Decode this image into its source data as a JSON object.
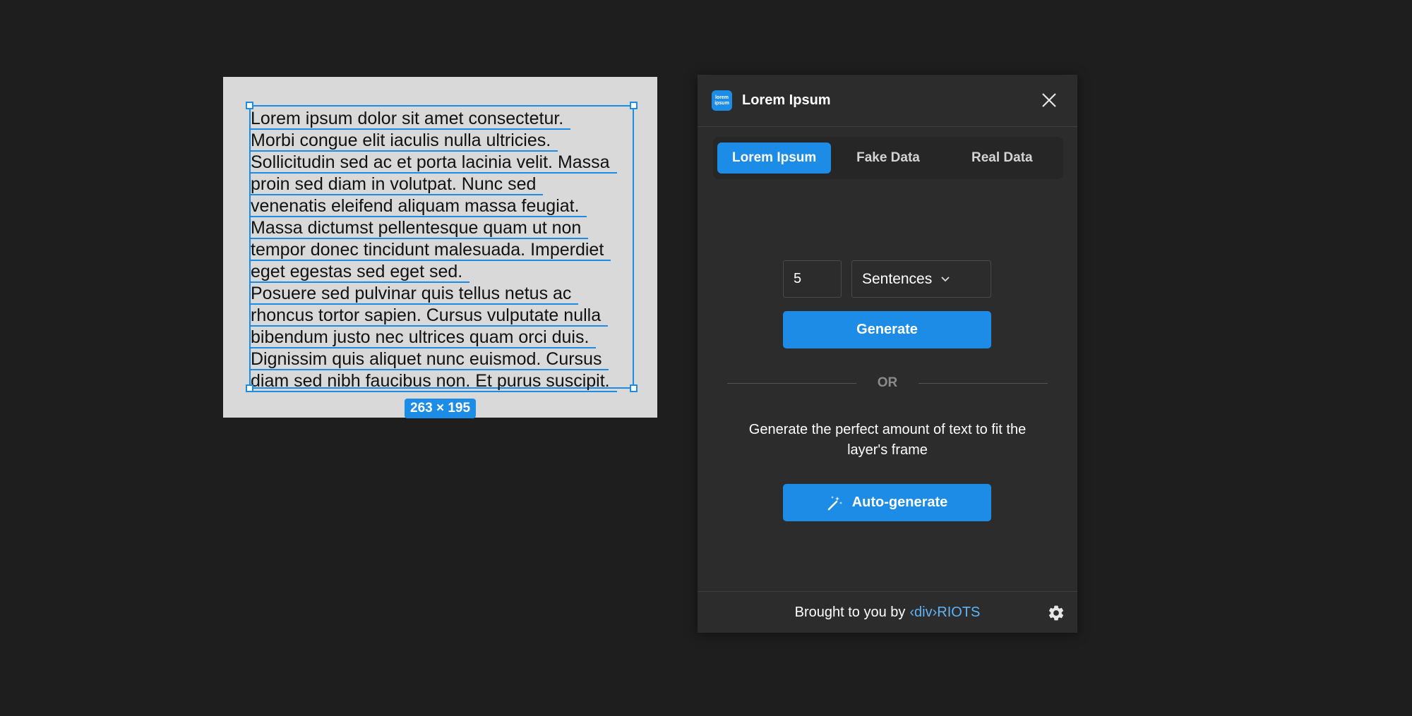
{
  "canvas": {
    "text_lines": [
      "Lorem ipsum dolor sit amet consectetur.",
      "Morbi congue elit iaculis nulla ultricies.",
      "Sollicitudin sed ac et porta lacinia velit. Massa",
      "proin sed diam in volutpat. Nunc sed",
      "venenatis eleifend aliquam massa feugiat.",
      "Massa dictumst pellentesque quam ut non",
      "tempor donec tincidunt malesuada. Imperdiet",
      "eget egestas sed eget sed.",
      "Posuere sed pulvinar quis tellus netus ac",
      "rhoncus tortor sapien. Cursus vulputate nulla",
      "bibendum justo nec ultrices quam orci duis.",
      "Dignissim quis aliquet nunc euismod. Cursus",
      "diam sed nibh faucibus non. Et purus suscipit."
    ],
    "dimensions": "263 × 195"
  },
  "panel": {
    "logo_text": "lorem ipsum",
    "title": "Lorem Ipsum",
    "tabs": [
      {
        "label": "Lorem Ipsum",
        "active": true
      },
      {
        "label": "Fake Data",
        "active": false
      },
      {
        "label": "Real Data",
        "active": false
      }
    ],
    "count_value": "5",
    "unit_selected": "Sentences",
    "generate_label": "Generate",
    "or_label": "OR",
    "description": "Generate the perfect amount of text to fit the layer's frame",
    "auto_generate_label": "Auto-generate",
    "footer_text": "Brought to you by",
    "footer_link": "‹div›RIOTS"
  },
  "colors": {
    "accent": "#1c8ce6",
    "link": "#5fb4f5",
    "background": "#1e1e1e",
    "panel": "#2c2c2c"
  },
  "icons": [
    "close-icon",
    "chevron-down-icon",
    "magic-wand-icon",
    "gear-icon"
  ]
}
